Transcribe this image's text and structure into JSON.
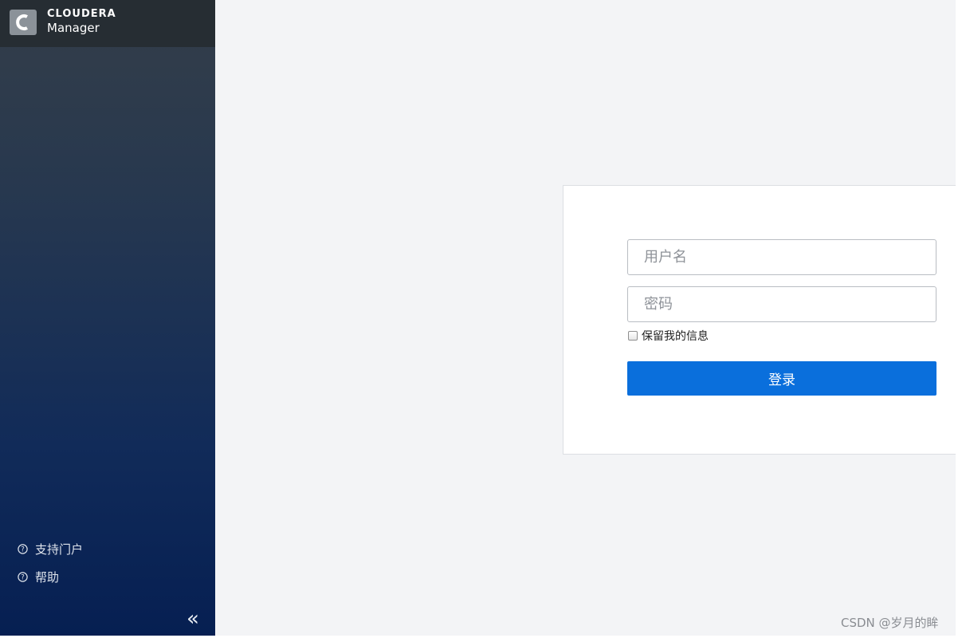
{
  "brand": {
    "line1": "CLOUDERA",
    "line2": "Manager",
    "logo_icon": "cloudera-c-logo-icon"
  },
  "sidebar": {
    "links": [
      {
        "label": "支持门户",
        "icon": "question-circle-icon"
      },
      {
        "label": "帮助",
        "icon": "question-circle-icon"
      }
    ],
    "collapse_label": "«"
  },
  "login": {
    "username_placeholder": "用户名",
    "username_value": "",
    "password_placeholder": "密码",
    "password_value": "",
    "remember_label": "保留我的信息",
    "remember_checked": false,
    "submit_label": "登录"
  },
  "watermark": "CSDN @岁月的眸",
  "colors": {
    "brand_bar": "#262d33",
    "sidebar_top": "#343e49",
    "sidebar_bottom": "#061f52",
    "main_background": "#f3f4f6",
    "primary_button": "#0a6fdc"
  }
}
